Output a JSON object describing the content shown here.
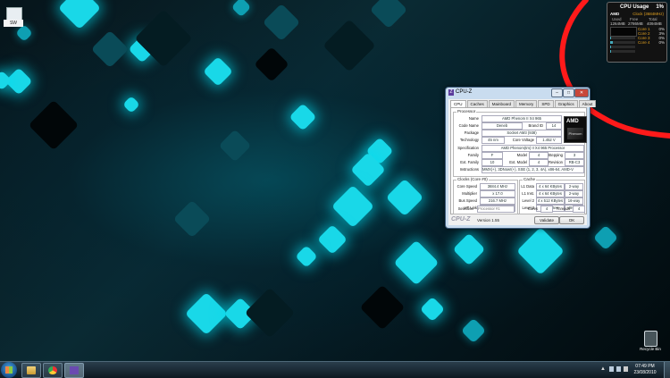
{
  "desktop": {
    "top_left_icon_label": "SW"
  },
  "gadget": {
    "title": "CPU Usage",
    "total_percent": "1%",
    "vendor": "AMD",
    "clock": "Clock (3684MHz)",
    "mem_headers": [
      "Used",
      "Free",
      "Total"
    ],
    "mem_values": [
      "1264MB",
      "2786MB",
      "4094MB"
    ],
    "cores": [
      {
        "label": "Core 1",
        "value": "0%"
      },
      {
        "label": "Core 2",
        "value": "3%"
      },
      {
        "label": "Core 3",
        "value": "0%"
      },
      {
        "label": "Core 4",
        "value": "0%"
      }
    ],
    "accent": "#e0a020"
  },
  "cpuz": {
    "title": "CPU-Z",
    "tabs": [
      "CPU",
      "Caches",
      "Mainboard",
      "Memory",
      "SPD",
      "Graphics",
      "About"
    ],
    "processor": {
      "group": "Processor",
      "name_label": "Name",
      "name": "AMD Phenom II X4 965",
      "codename_label": "Code Name",
      "codename": "Deneb",
      "brandid_label": "Brand ID",
      "brandid": "14",
      "package_label": "Package",
      "package": "Socket AM3 (938)",
      "tech_label": "Technology",
      "tech": "45 nm",
      "voltage_label": "Core Voltage",
      "voltage": "1.452 V",
      "spec_label": "Specification",
      "spec": "AMD Phenom(tm) II X4 965 Processor",
      "family_label": "Family",
      "family": "F",
      "model_label": "Model",
      "model": "4",
      "stepping_label": "Stepping",
      "stepping": "3",
      "extfamily_label": "Ext. Family",
      "extfamily": "10",
      "extmodel_label": "Ext. Model",
      "extmodel": "4",
      "revision_label": "Revision",
      "revision": "RB-C3",
      "instr_label": "Instructions",
      "instr": "MMX(+), 3DNow!(+), SSE (1, 2, 3, 4A), x86-64, AMD-V"
    },
    "clocks": {
      "group": "Clocks (Core #0)",
      "speed_label": "Core Speed",
      "speed": "3684.4 MHz",
      "mult_label": "Multiplier",
      "mult": "x 17.0",
      "bus_label": "Bus Speed",
      "bus": "216.7 MHz",
      "ht_label": "HT Link",
      "ht": "1950.6 MHz"
    },
    "cache": {
      "group": "Cache",
      "l1d_label": "L1 Data",
      "l1d": "4 x 64 KBytes",
      "l1d_way": "2-way",
      "l1i_label": "L1 Inst.",
      "l1i": "4 x 64 KBytes",
      "l1i_way": "2-way",
      "l2_label": "Level 2",
      "l2": "4 x 512 KBytes",
      "l2_way": "16-way",
      "l3_label": "Level 3",
      "l3": "6 MBytes",
      "l3_way": "48-way"
    },
    "selection_label": "Selection",
    "selection": "Processor #1",
    "cores_label": "Cores",
    "cores": "4",
    "threads_label": "Threads",
    "threads": "4",
    "brand": "CPU-Z",
    "version": "Version 1.55",
    "validate": "Validate",
    "ok": "OK",
    "logo_text": "AMD",
    "logo_sub": "Phenom II"
  },
  "recycle_bin": {
    "label": "Recycle Bin"
  },
  "taskbar": {
    "apps": [
      "explorer-icon",
      "chrome-icon",
      "cpuz-icon"
    ],
    "time": "07:49 PM",
    "date": "23/08/2010"
  },
  "colors": {
    "glow": "#19d8e8",
    "annotation": "#ff1a1a"
  }
}
